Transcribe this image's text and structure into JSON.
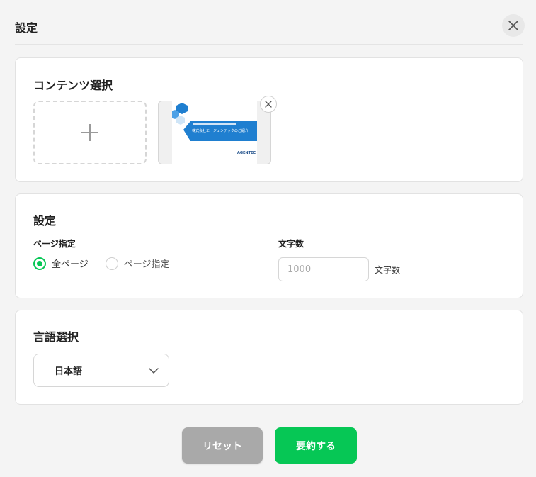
{
  "header": {
    "title": "設定"
  },
  "content_section": {
    "title": "コンテンツ選択",
    "thumbnail": {
      "line1": "株式会社エージェンテックのご紹介",
      "brand": "AGENTEC"
    }
  },
  "settings_section": {
    "title": "設定",
    "page_label": "ページ指定",
    "radio_all": "全ページ",
    "radio_specify": "ページ指定",
    "selected": "all",
    "chars_label": "文字数",
    "chars_placeholder": "1000",
    "chars_unit": "文字数"
  },
  "language_section": {
    "title": "言語選択",
    "selected": "日本語"
  },
  "buttons": {
    "reset": "リセット",
    "submit": "要約する"
  },
  "colors": {
    "accent": "#06c755",
    "disabled": "#a9a9a9",
    "thumb_blue": "#1f7fd0"
  }
}
